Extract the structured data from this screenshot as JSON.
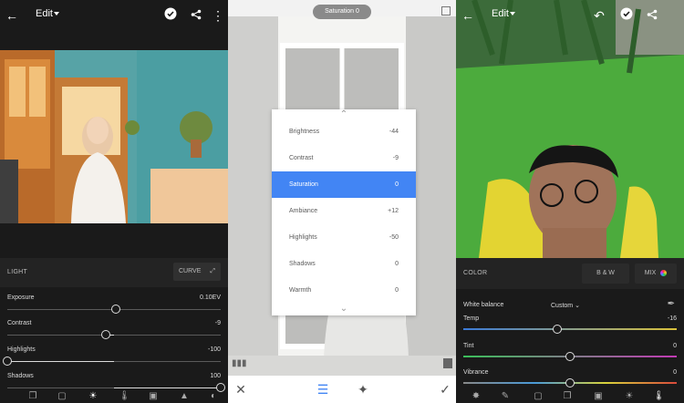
{
  "lightroom_left": {
    "header": {
      "title": "Edit"
    },
    "section_label": "LIGHT",
    "curve_button": "CURVE",
    "sliders": [
      {
        "name": "Exposure",
        "value": "0.10EV",
        "position": 0.51
      },
      {
        "name": "Contrast",
        "value": "-9",
        "position": 0.46
      },
      {
        "name": "Highlights",
        "value": "-100",
        "position": 0.0
      },
      {
        "name": "Shadows",
        "value": "100",
        "position": 1.0
      }
    ]
  },
  "snapseed": {
    "status_pill": "Saturation 0",
    "items": [
      {
        "name": "Brightness",
        "value": "-44",
        "selected": false
      },
      {
        "name": "Contrast",
        "value": "-9",
        "selected": false
      },
      {
        "name": "Saturation",
        "value": "0",
        "selected": true
      },
      {
        "name": "Ambiance",
        "value": "+12",
        "selected": false
      },
      {
        "name": "Highlights",
        "value": "-50",
        "selected": false
      },
      {
        "name": "Shadows",
        "value": "0",
        "selected": false
      },
      {
        "name": "Warmth",
        "value": "0",
        "selected": false
      }
    ],
    "accent_color": "#4285f4"
  },
  "lightroom_right": {
    "header": {
      "title": "Edit"
    },
    "section_label": "COLOR",
    "bw_button": "B & W",
    "mix_button": "MIX",
    "white_balance_label": "White balance",
    "white_balance_value": "Custom",
    "sliders": [
      {
        "name": "Temp",
        "value": "-16",
        "position": 0.44
      },
      {
        "name": "Tint",
        "value": "0",
        "position": 0.5
      },
      {
        "name": "Vibrance",
        "value": "0",
        "position": 0.5
      }
    ]
  }
}
